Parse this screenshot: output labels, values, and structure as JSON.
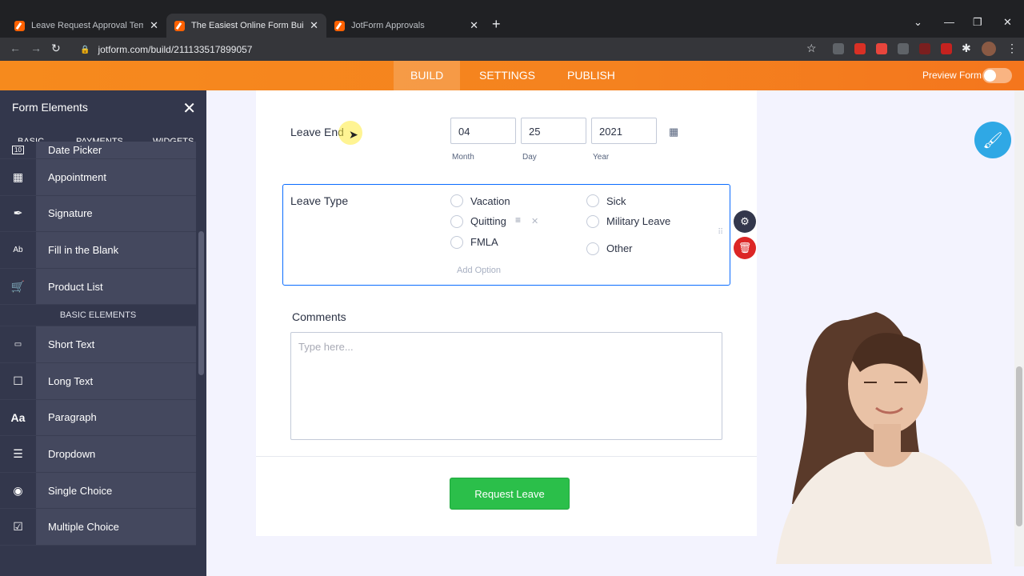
{
  "browser": {
    "tabs": [
      {
        "title": "Leave Request Approval Template",
        "active": false
      },
      {
        "title": "The Easiest Online Form Builder",
        "active": true
      },
      {
        "title": "JotForm Approvals",
        "active": false
      }
    ],
    "url": "jotform.com/build/211133517899057"
  },
  "builder_nav": {
    "tabs": [
      "BUILD",
      "SETTINGS",
      "PUBLISH"
    ],
    "active_tab": "BUILD",
    "preview_label": "Preview Form"
  },
  "sidebar": {
    "title": "Form Elements",
    "tabs": [
      "BASIC",
      "PAYMENTS",
      "WIDGETS"
    ],
    "items_top": [
      {
        "label": "Date Picker",
        "icon": "calendar-icon"
      },
      {
        "label": "Appointment",
        "icon": "appointment-icon"
      },
      {
        "label": "Signature",
        "icon": "pen-icon"
      },
      {
        "label": "Fill in the Blank",
        "icon": "fill-blank-icon"
      },
      {
        "label": "Product List",
        "icon": "cart-icon"
      }
    ],
    "section_label": "BASIC ELEMENTS",
    "items_basic": [
      {
        "label": "Short Text",
        "icon": "short-text-icon"
      },
      {
        "label": "Long Text",
        "icon": "long-text-icon"
      },
      {
        "label": "Paragraph",
        "icon": "paragraph-icon"
      },
      {
        "label": "Dropdown",
        "icon": "dropdown-icon"
      },
      {
        "label": "Single Choice",
        "icon": "radio-icon"
      },
      {
        "label": "Multiple Choice",
        "icon": "checkbox-icon"
      }
    ],
    "icon_glyphs": {
      "date_picker": "10",
      "fill_blank": "Ab"
    }
  },
  "form": {
    "leave_end": {
      "label": "Leave End",
      "month": "04",
      "day": "25",
      "year": "2021",
      "month_label": "Month",
      "day_label": "Day",
      "year_label": "Year"
    },
    "leave_type": {
      "label": "Leave Type",
      "options_left": [
        "Vacation",
        "Quitting",
        "FMLA"
      ],
      "options_right": [
        "Sick",
        "Military Leave",
        "Other"
      ],
      "add_option": "Add Option"
    },
    "comments": {
      "label": "Comments",
      "placeholder": "Type here..."
    },
    "submit_label": "Request Leave"
  },
  "colors": {
    "accent_orange": "#f68a1d",
    "sidebar_bg": "#33374c",
    "selection_blue": "#0a6cff",
    "submit_green": "#2bbf4a",
    "delete_red": "#dc2626"
  }
}
